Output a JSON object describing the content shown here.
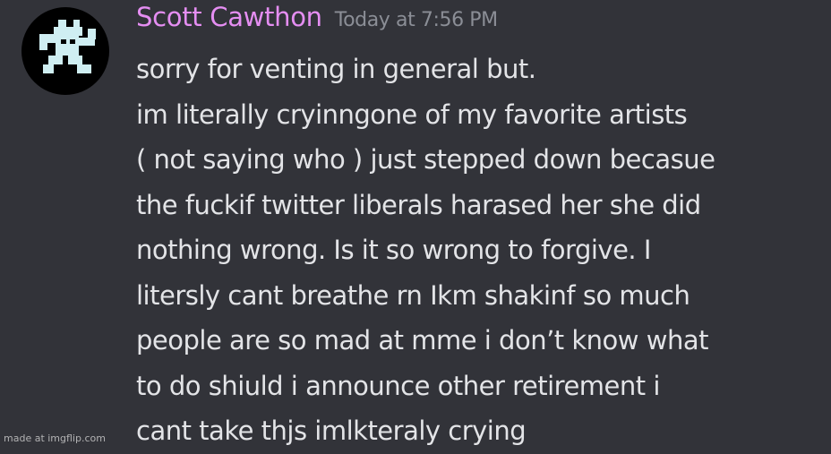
{
  "message": {
    "author": "Scott Cawthon",
    "timestamp": "Today at 7:56 PM",
    "avatar_icon": "pixel-character-icon",
    "lines": [
      "sorry for venting in general but.",
      "im literally cryinngone of my favorite artists",
      "( not saying who ) just stepped down becasue",
      "the fuckif twitter liberals harased her she did",
      "nothing wrong. Is it so wrong to forgive. I",
      "litersly cant breathe rn Ikm shakinf so much",
      "people are so mad at mme i don’t know what",
      "to do shiuld i announce other retirement i",
      "cant take thjs imlkteraly crying"
    ]
  },
  "watermark": "made at imgflip.com",
  "colors": {
    "background": "#323339",
    "username": "#e58ef2",
    "timestamp": "#8b8e96",
    "text": "#e3e4e7",
    "avatar_bg": "#000000",
    "avatar_figure": "#cfeef2"
  }
}
